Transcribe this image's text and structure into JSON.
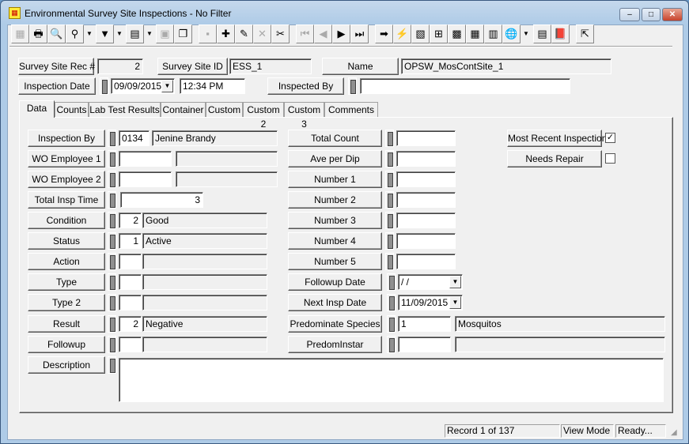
{
  "window": {
    "title": "Environmental Survey Site Inspections - No Filter",
    "minimize": "–",
    "maximize": "□",
    "close": "✕"
  },
  "toolbar": [
    {
      "name": "form-view-icon",
      "glyph": "▦",
      "disabled": true
    },
    {
      "name": "print-icon",
      "glyph": "🖶"
    },
    {
      "name": "print-preview-icon",
      "glyph": "🔍"
    },
    {
      "name": "find-icon",
      "glyph": "⚲",
      "dropdown": true
    },
    {
      "name": "filter-icon",
      "glyph": "▼",
      "dropdown": true
    },
    {
      "name": "report-icon",
      "glyph": "▤",
      "dropdown": true
    },
    {
      "name": "properties-icon",
      "glyph": "▣",
      "disabled": true
    },
    {
      "name": "copy-record-icon",
      "glyph": "❐"
    },
    {
      "name": "save-icon",
      "glyph": "▪",
      "disabled": true
    },
    {
      "name": "add-record-icon",
      "glyph": "✚"
    },
    {
      "name": "edit-pencil-icon",
      "glyph": "✎"
    },
    {
      "name": "delete-icon",
      "glyph": "✕",
      "disabled": true
    },
    {
      "name": "cut-icon",
      "glyph": "✂"
    },
    {
      "name": "first-record-icon",
      "glyph": "⏮",
      "disabled": true
    },
    {
      "name": "previous-record-icon",
      "glyph": "◀",
      "disabled": true
    },
    {
      "name": "next-record-icon",
      "glyph": "▶"
    },
    {
      "name": "last-record-icon",
      "glyph": "⏭"
    },
    {
      "name": "goto-arrow-icon",
      "glyph": "➡"
    },
    {
      "name": "lightning-icon",
      "glyph": "⚡"
    },
    {
      "name": "relations-icon",
      "glyph": "▧"
    },
    {
      "name": "hierarchy-icon",
      "glyph": "⊞"
    },
    {
      "name": "equipment-icon",
      "glyph": "▩"
    },
    {
      "name": "calculator-icon",
      "glyph": "▦"
    },
    {
      "name": "chart-icon",
      "glyph": "▥"
    },
    {
      "name": "globe-map-icon",
      "glyph": "🌐",
      "dropdown": true
    },
    {
      "name": "spreadsheet-icon",
      "glyph": "▤"
    },
    {
      "name": "help-book-icon",
      "glyph": "📕"
    },
    {
      "name": "exit-icon",
      "glyph": "⇱"
    }
  ],
  "header": {
    "rec_label": "Survey Site Rec #",
    "rec_value": "2",
    "site_id_label": "Survey Site ID",
    "site_id_value": "ESS_1",
    "name_label": "Name",
    "name_value": "OPSW_MosContSite_1",
    "insp_date_label": "Inspection Date",
    "insp_date_value": "09/09/2015",
    "insp_time_value": "12:34 PM",
    "inspected_by_label": "Inspected By",
    "inspected_by_value": ""
  },
  "tabs": [
    "Data",
    "Counts",
    "Lab Test Results",
    "Container",
    "Custom",
    "Custom 2",
    "Custom 3",
    "Comments"
  ],
  "left_fields": [
    {
      "label": "Inspection By",
      "code": "0134",
      "desc": "Jenine Brandy"
    },
    {
      "label": "WO Employee 1",
      "code": "",
      "desc": ""
    },
    {
      "label": "WO Employee 2",
      "code": "",
      "desc": ""
    },
    {
      "label": "Total Insp Time",
      "code": "3"
    },
    {
      "label": "Condition",
      "code": "2",
      "desc": "Good"
    },
    {
      "label": "Status",
      "code": "1",
      "desc": "Active"
    },
    {
      "label": "Action",
      "code": "",
      "desc": ""
    },
    {
      "label": "Type",
      "code": "",
      "desc": ""
    },
    {
      "label": "Type 2",
      "code": "",
      "desc": ""
    },
    {
      "label": "Result",
      "code": "2",
      "desc": "Negative"
    },
    {
      "label": "Followup",
      "code": "",
      "desc": ""
    }
  ],
  "description": {
    "label": "Description",
    "value": ""
  },
  "mid_fields": [
    {
      "label": "Total Count",
      "value": ""
    },
    {
      "label": "Ave per Dip",
      "value": ""
    },
    {
      "label": "Number 1",
      "value": ""
    },
    {
      "label": "Number 2",
      "value": ""
    },
    {
      "label": "Number 3",
      "value": ""
    },
    {
      "label": "Number 4",
      "value": ""
    },
    {
      "label": "Number 5",
      "value": ""
    },
    {
      "label": "Followup Date",
      "value": " /  /"
    },
    {
      "label": "Next Insp Date",
      "value": "11/09/2015"
    },
    {
      "label": "Predominate Species",
      "value": "1",
      "desc": "Mosquitos"
    },
    {
      "label": "PredomInstar",
      "value": "",
      "desc": ""
    }
  ],
  "right": {
    "most_recent_label": "Most Recent Inspection",
    "most_recent_checked": true,
    "needs_repair_label": "Needs Repair",
    "needs_repair_checked": false,
    "check_glyph": "✓"
  },
  "status": {
    "record": "Record 1 of 137",
    "mode": "View Mode",
    "state": "Ready..."
  }
}
